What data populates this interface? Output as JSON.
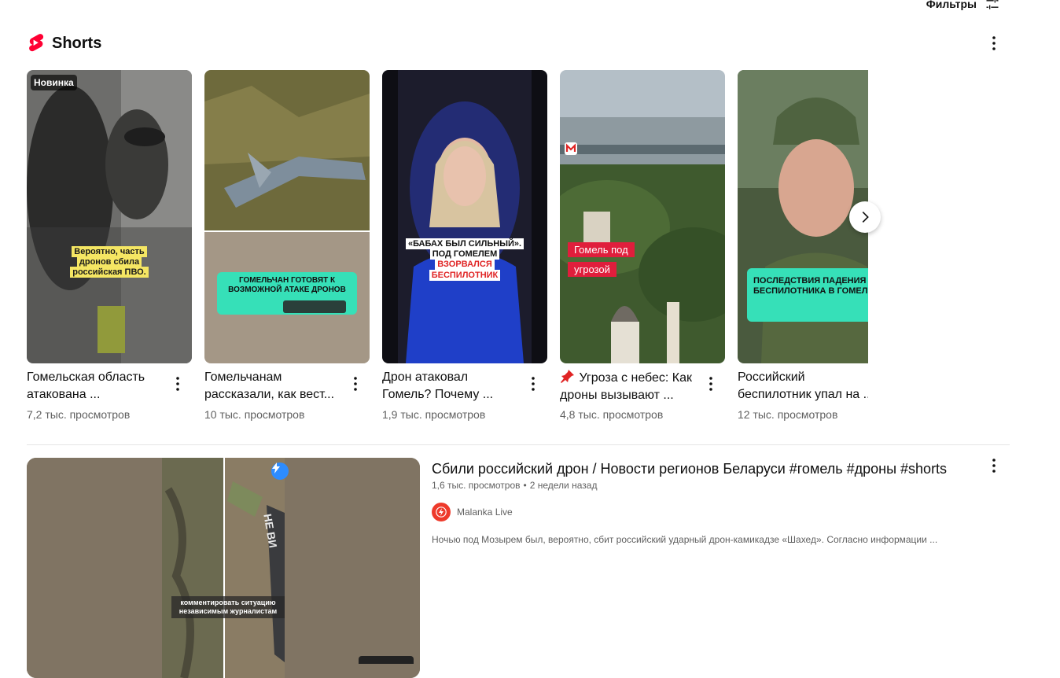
{
  "filters": {
    "label": "Фильтры",
    "icon": "sliders-icon"
  },
  "shorts_shelf": {
    "title": "Shorts",
    "logo_icon": "shorts-logo-icon",
    "menu_icon": "more-vert-icon",
    "next_icon": "chevron-right-icon",
    "cards": [
      {
        "badge": "Новинка",
        "overlay": "Вероятно, часть дронов сбила российская ПВО.",
        "title_line1": "Гомельская область",
        "title_line2": "атакована ...",
        "views": "7,2 тыс. просмотров"
      },
      {
        "overlay": "ГОМЕЛЬЧАН ГОТОВЯТ К ВОЗМОЖНОЙ АТАКЕ ДРОНОВ",
        "title_line1": "Гомельчанам",
        "title_line2": "рассказали, как вест...",
        "views": "10 тыс. просмотров"
      },
      {
        "overlay_line1": "«БАБАХ БЫЛ СИЛЬНЫЙ».",
        "overlay_line2": "ПОД ГОМЕЛЕМ",
        "overlay_line3": "ВЗОРВАЛСЯ",
        "overlay_line4": "БЕСПИЛОТНИК",
        "title_line1": "Дрон атаковал",
        "title_line2": "Гомель? Почему ...",
        "views": "1,9 тыс. просмотров"
      },
      {
        "overlay_line1": "Гомель под",
        "overlay_line2": "угрозой",
        "pin_icon": "pushpin-icon",
        "title_line1": "Угроза с небес: Как",
        "title_line2": "дроны вызывают ...",
        "views": "4,8 тыс. просмотров"
      },
      {
        "overlay": "ПОСЛЕДСТВИЯ ПАДЕНИЯ БЕСПИЛОТНИКА В ГОМЕЛ",
        "title_line1": "Российский",
        "title_line2": "беспилотник упал на ...",
        "views": "12 тыс. просмотров"
      }
    ]
  },
  "video": {
    "title": "Сбили российский дрон / Новости регионов Беларуси #гомель #дроны #shorts",
    "views": "1,6 тыс. просмотров",
    "separator": "•",
    "age": "2 недели назад",
    "channel": "Malanka Live",
    "channel_icon": "lightning-icon",
    "description": "Ночью под Мозырем был, вероятно, сбит российский ударный дрон-камикадзе «Шахед». Согласно информации ...",
    "thumb_caption": "комментировать ситуацию независимым журналистам",
    "thumb_label": "НЕ ВИ"
  }
}
